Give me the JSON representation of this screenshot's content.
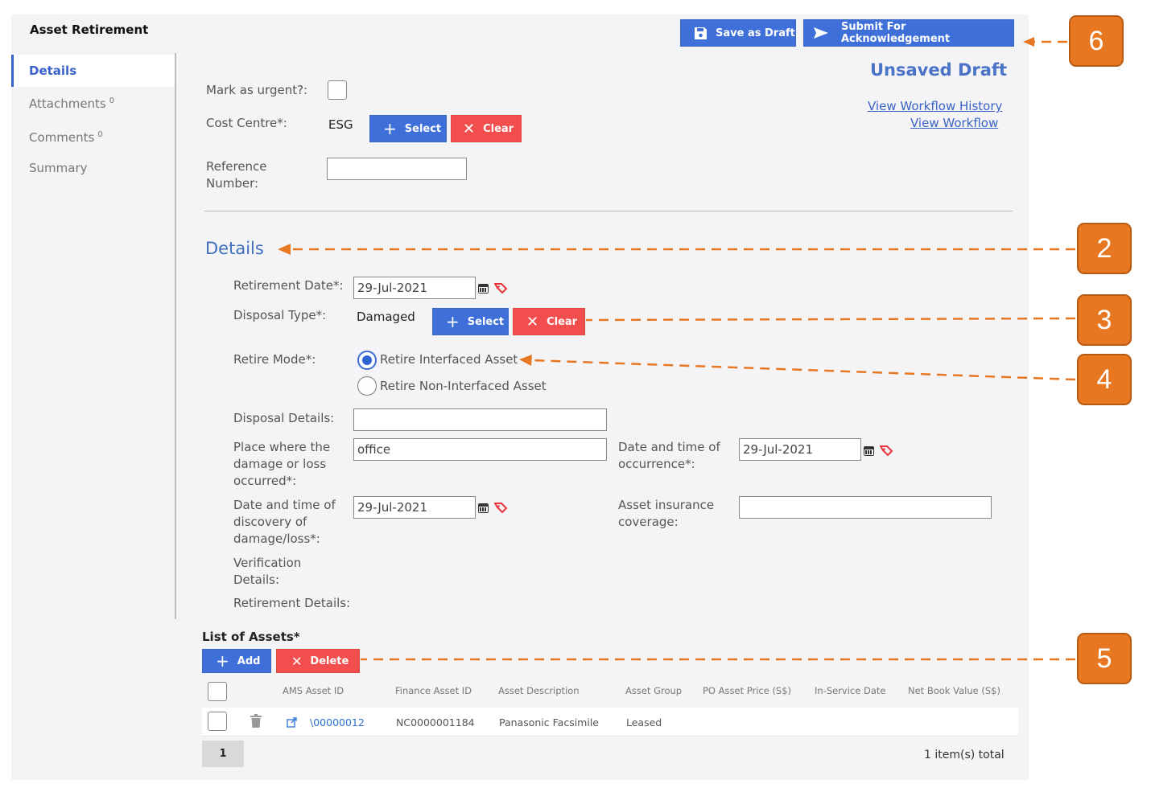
{
  "header": {
    "title": "Asset Retirement",
    "save_draft_label": "Save as Draft",
    "submit_label": "Submit For Acknowledgement"
  },
  "sidebar": {
    "items": [
      {
        "label": "Details",
        "count": ""
      },
      {
        "label": "Attachments",
        "count": "0"
      },
      {
        "label": "Comments",
        "count": "0"
      },
      {
        "label": "Summary",
        "count": ""
      }
    ]
  },
  "status": {
    "draft_label": "Unsaved Draft",
    "workflow_history_link": "View Workflow History",
    "workflow_link": "View Workflow"
  },
  "form": {
    "urgent_label": "Mark as urgent?:",
    "cost_centre_label": "Cost Centre*:",
    "cost_centre_value": "ESG",
    "select_label": "Select",
    "clear_label": "Clear",
    "reference_label_1": "Reference",
    "reference_label_2": "Number:",
    "reference_value": ""
  },
  "details": {
    "section_title": "Details",
    "retirement_date_label": "Retirement Date*:",
    "retirement_date_value": "29-Jul-2021",
    "disposal_type_label": "Disposal Type*:",
    "disposal_type_value": "Damaged",
    "retire_mode_label": "Retire Mode*:",
    "retire_mode_options": [
      "Retire Interfaced Asset",
      "Retire Non-Interfaced Asset"
    ],
    "retire_mode_selected": "Retire Interfaced Asset",
    "disposal_details_label": "Disposal Details:",
    "disposal_details_value": "",
    "place_label": [
      "Place where the",
      "damage or loss",
      "occurred*:"
    ],
    "place_value": "office",
    "occurrence_label": [
      "Date and time of",
      "occurrence*:"
    ],
    "occurrence_value": "29-Jul-2021",
    "discovery_label": [
      "Date and time of",
      "discovery of",
      "damage/loss*:"
    ],
    "discovery_value": "29-Jul-2021",
    "insurance_label": [
      "Asset insurance",
      "coverage:"
    ],
    "insurance_value": "",
    "verification_label": [
      "Verification",
      "Details:"
    ],
    "retirement_details_label": "Retirement Details:"
  },
  "assets": {
    "title": "List of Assets*",
    "add_label": "Add",
    "delete_label": "Delete",
    "columns": [
      "AMS Asset ID",
      "Finance Asset ID",
      "Asset Description",
      "Asset Group",
      "PO Asset Price (S$)",
      "In-Service Date",
      "Net Book Value (S$)"
    ],
    "rows": [
      {
        "ams_id": "\\00000012",
        "finance_id": "NC0000001184",
        "description": "Panasonic Facsimile",
        "group": "Leased",
        "price": "",
        "in_service": "",
        "nbv": ""
      }
    ],
    "page": "1",
    "total": "1 item(s) total"
  },
  "callouts": [
    "6",
    "2",
    "3",
    "4",
    "5"
  ],
  "colors": {
    "primary": "#3f6fd9",
    "danger": "#f24e4e",
    "accent": "#3a63c9",
    "callout": "#e87722"
  }
}
